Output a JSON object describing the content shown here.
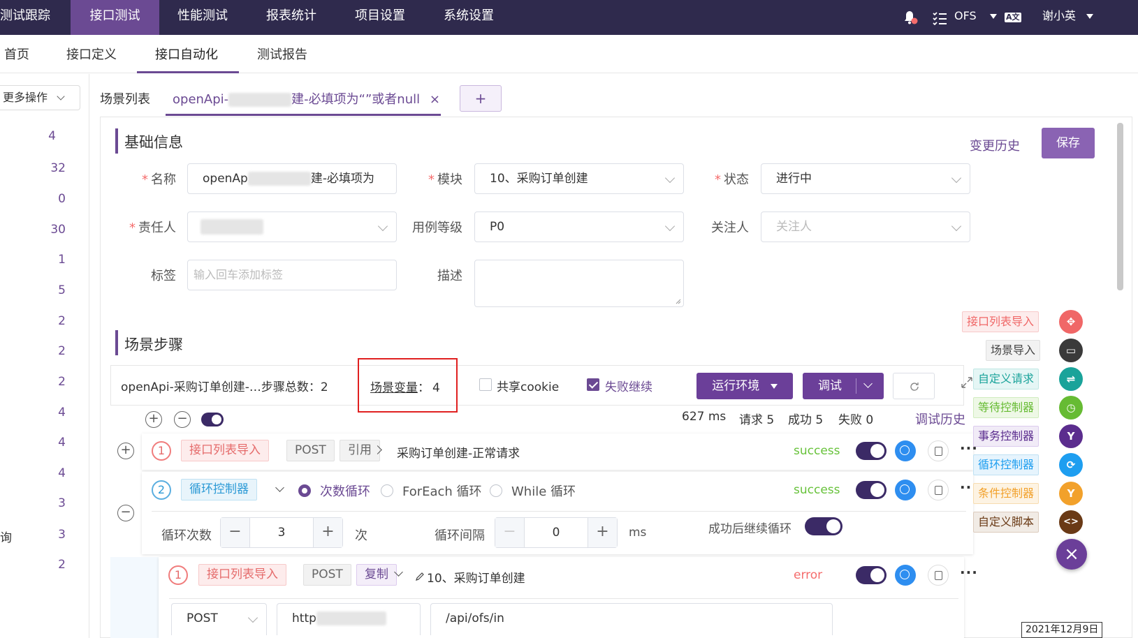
{
  "topnav": {
    "items": [
      "测试跟踪",
      "接口测试",
      "性能测试",
      "报表统计",
      "项目设置",
      "系统设置"
    ],
    "project": "OFS",
    "user": "谢小英",
    "translate_icon": "A文"
  },
  "subnav": {
    "items": [
      "首页",
      "接口定义",
      "接口自动化",
      "测试报告"
    ]
  },
  "left": {
    "more_label": "更多操作",
    "counts": [
      "4",
      "32",
      "0",
      "30",
      "1",
      "5",
      "2",
      "2",
      "2",
      "4",
      "4",
      "4",
      "3",
      "3",
      "2"
    ],
    "partial_label": "询"
  },
  "tabs": {
    "list_label": "场景列表",
    "active_tab_prefix": "openApi-",
    "active_tab_suffix": "建-必填项为“”或者null",
    "close": "×",
    "add": "+"
  },
  "basic": {
    "title": "基础信息",
    "history": "变更历史",
    "save": "保存",
    "name_label": "名称",
    "name_value_prefix": "openAp",
    "name_value_suffix": "建-必填项为",
    "module_label": "模块",
    "module_value": "10、采购订单创建",
    "status_label": "状态",
    "status_value": "进行中",
    "owner_label": "责任人",
    "level_label": "用例等级",
    "level_value": "P0",
    "follow_label": "关注人",
    "follow_placeholder": "关注人",
    "tag_label": "标签",
    "tag_placeholder": "输入回车添加标签",
    "desc_label": "描述"
  },
  "steps": {
    "title": "场景步骤",
    "scenario_name": "openApi-采购订单创建-…",
    "total_label": "步骤总数：2",
    "variables_label": "场景变量",
    "variables_colon": "：",
    "variables_count": "4",
    "share_cookie": "共享cookie",
    "fail_continue": "失败继续",
    "env_btn": "运行环境",
    "debug_btn": "调试",
    "time": "627 ms",
    "requests": "请求 5",
    "success": "成功 5",
    "fail": "失败 0",
    "debug_history": "调试历史"
  },
  "step1": {
    "num": "1",
    "tag": "接口列表导入",
    "method": "POST",
    "ref": "引用",
    "name": "采购订单创建-正常请求",
    "status": "success"
  },
  "step2": {
    "num": "2",
    "tag": "循环控制器",
    "radio1": "次数循环",
    "radio2": "ForEach 循环",
    "radio3": "While 循环",
    "status": "success",
    "loop_count_label": "循环次数",
    "loop_count": "3",
    "loop_unit": "次",
    "interval_label": "循环间隔",
    "interval": "0",
    "interval_unit": "ms",
    "continue_label": "成功后继续循环"
  },
  "step3": {
    "num": "1",
    "tag": "接口列表导入",
    "method": "POST",
    "copy": "复制",
    "name": "10、采购订单创建",
    "status": "error",
    "method_select": "POST",
    "url_prefix": "http",
    "path": "/api/ofs/in"
  },
  "side": {
    "items": [
      {
        "label": "接口列表导入",
        "icon": "✥",
        "color": "#f06767"
      },
      {
        "label": "场景导入",
        "icon": "▭",
        "color": "#3a3a3a"
      },
      {
        "label": "自定义请求",
        "icon": "⇌",
        "color": "#1aa39a"
      },
      {
        "label": "等待控制器",
        "icon": "◷",
        "color": "#66bb33"
      },
      {
        "label": "事务控制器",
        "icon": "Y",
        "color": "#5b2d8e"
      },
      {
        "label": "循环控制器",
        "icon": "⟳",
        "color": "#1e9ef0"
      },
      {
        "label": "条件控制器",
        "icon": "Y",
        "color": "#f2a12b"
      },
      {
        "label": "自定义脚本",
        "icon": "<>",
        "color": "#6a3a16"
      }
    ],
    "close": "×"
  },
  "date_tooltip": "2021年12月9日"
}
